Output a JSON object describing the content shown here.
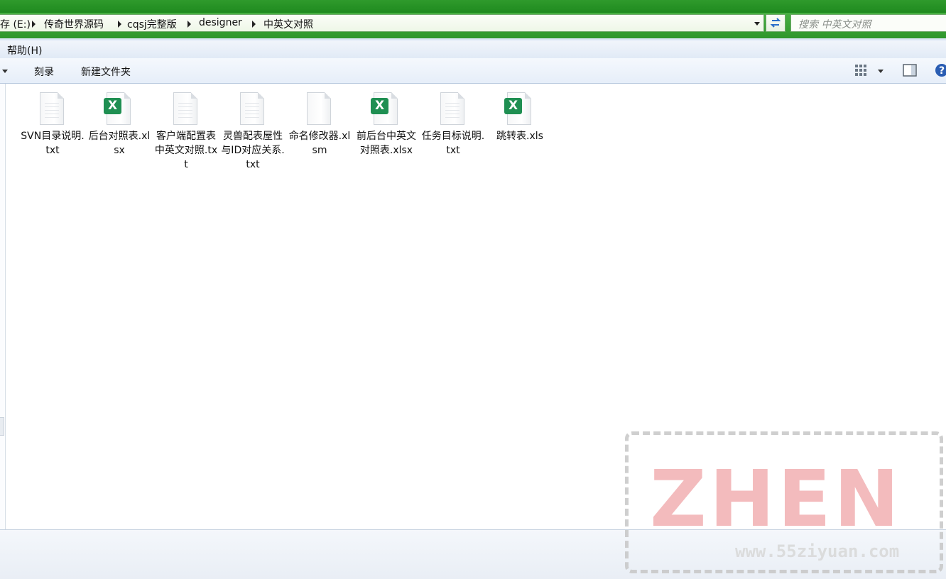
{
  "address_bar": {
    "breadcrumbs": [
      "存 (E:)",
      "传奇世界源码",
      "cqsj完整版",
      "designer",
      "中英文对照"
    ]
  },
  "search": {
    "placeholder": "搜索 中英文对照"
  },
  "menu": {
    "help": "帮助(H)"
  },
  "toolbar": {
    "burn": "刻录",
    "new_folder": "新建文件夹"
  },
  "files": [
    {
      "name": "SVN目录说明.txt",
      "type": "txt"
    },
    {
      "name": "后台对照表.xlsx",
      "type": "excel"
    },
    {
      "name": "客户端配置表中英文对照.txt",
      "type": "txt"
    },
    {
      "name": "灵兽配表屋性与ID对应关系.txt",
      "type": "txt"
    },
    {
      "name": "命名修改器.xlsm",
      "type": "blank"
    },
    {
      "name": "前后台中英文对照表.xlsx",
      "type": "excel"
    },
    {
      "name": "任务目标说明.txt",
      "type": "txt"
    },
    {
      "name": "跳转表.xls",
      "type": "excel"
    }
  ],
  "icons": {
    "excel_badge": "X",
    "excel_color": "#1f8f52"
  },
  "watermark": {
    "text": "ZHEN",
    "url": "www.55ziyuan.com"
  }
}
